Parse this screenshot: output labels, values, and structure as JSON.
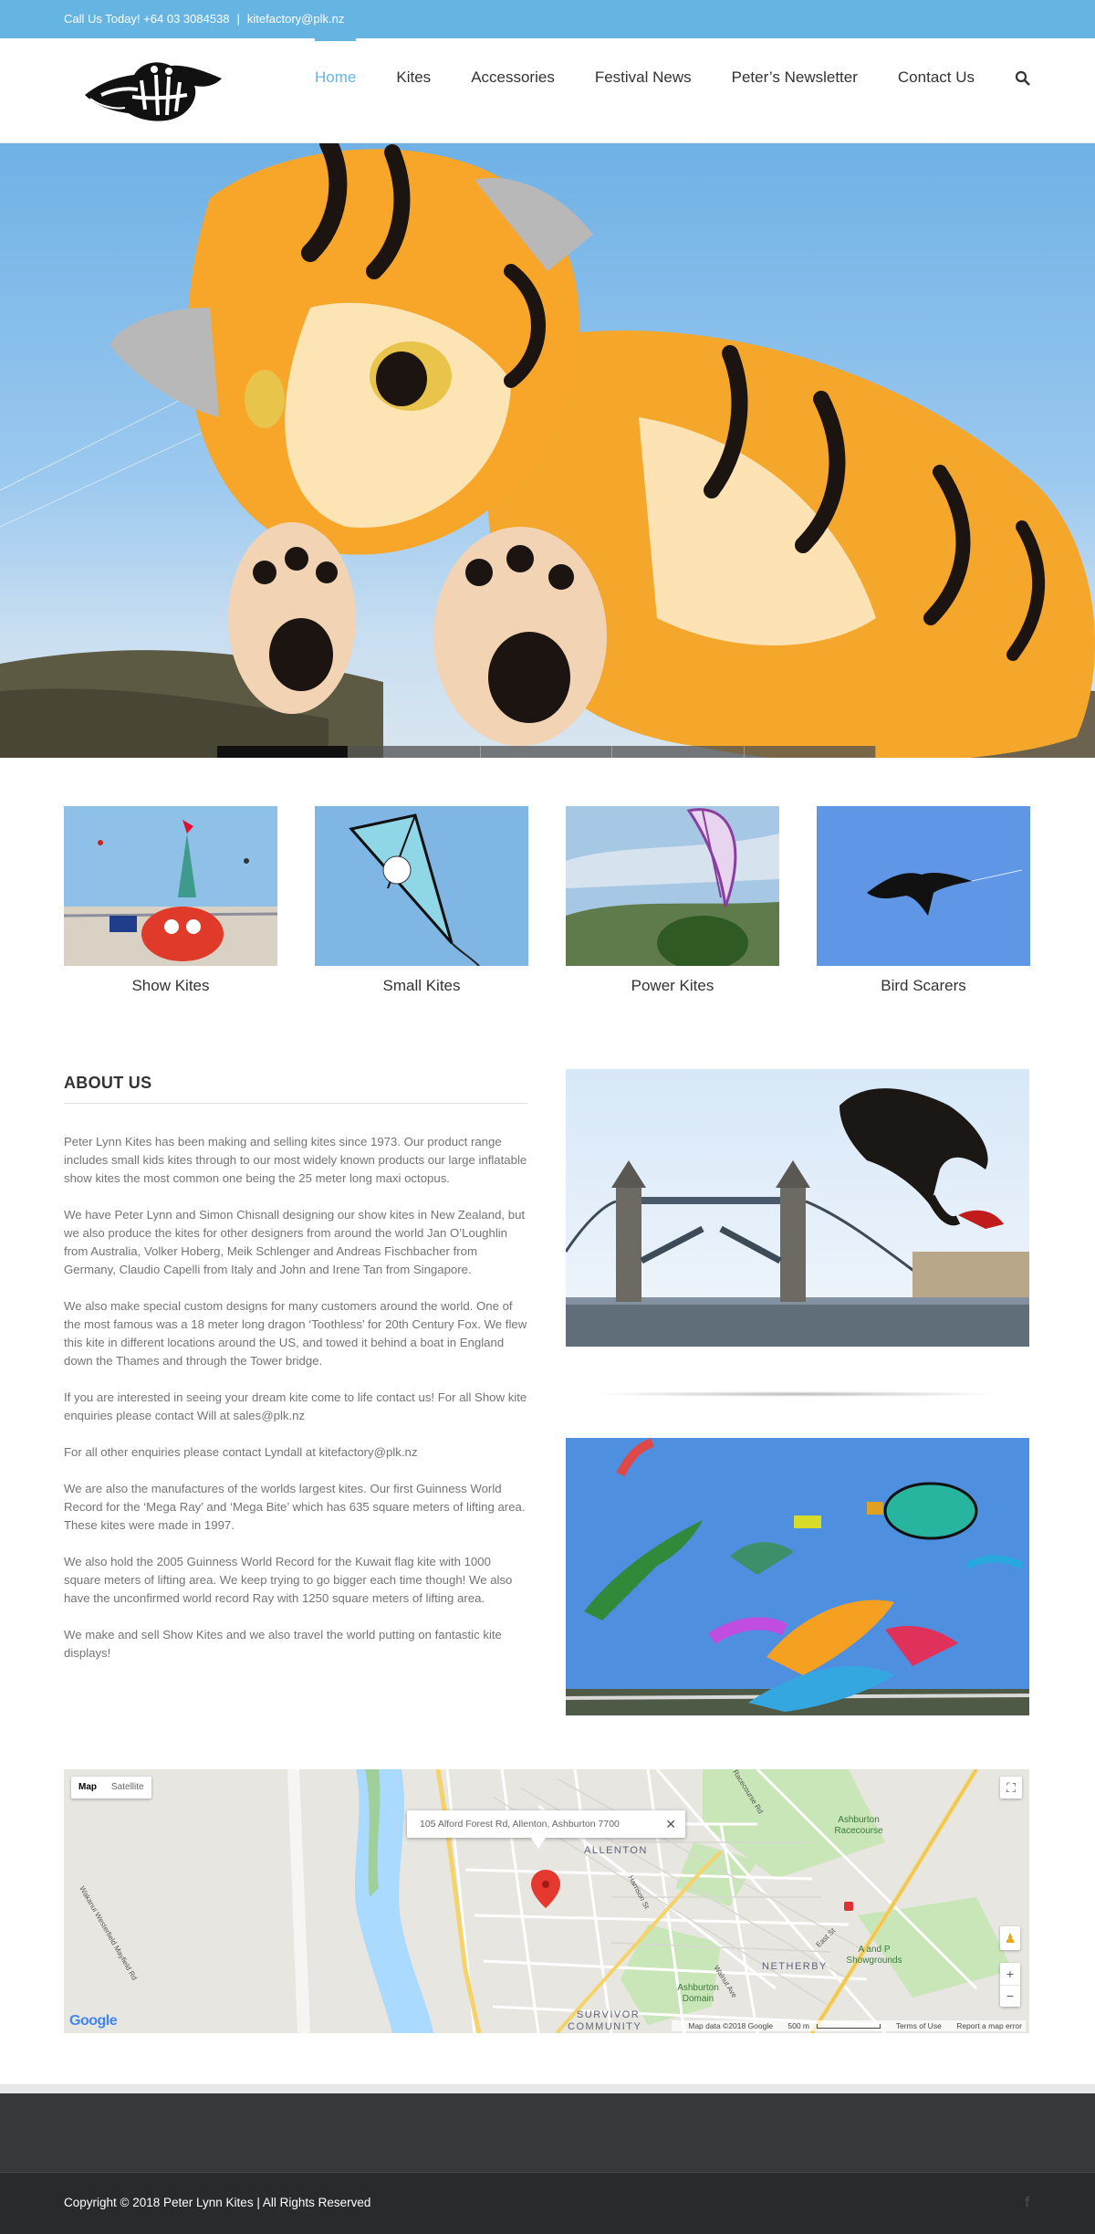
{
  "topbar": {
    "phone": "Call Us Today! +64 03 3084538",
    "separator": "|",
    "email": "kitefactory@plk.nz"
  },
  "header": {
    "logo_icon": "peter-lynn-kites-logo",
    "nav": [
      {
        "label": "Home",
        "active": true
      },
      {
        "label": "Kites",
        "active": false
      },
      {
        "label": "Accessories",
        "active": false
      },
      {
        "label": "Festival News",
        "active": false
      },
      {
        "label": "Peter’s Newsletter",
        "active": false
      },
      {
        "label": "Contact Us",
        "active": false
      }
    ],
    "search_icon": "search-icon",
    "accent_color": "#66b4e1"
  },
  "hero": {
    "slides": 5,
    "active_slide": 1
  },
  "categories": [
    {
      "label": "Show Kites"
    },
    {
      "label": "Small Kites"
    },
    {
      "label": "Power Kites"
    },
    {
      "label": "Bird Scarers"
    }
  ],
  "about": {
    "title": "ABOUT US",
    "paragraphs": [
      "Peter Lynn Kites has been making and selling kites since 1973. Our product range includes small kids kites through to our most widely known products our large inflatable show kites the most common one being the 25 meter long maxi octopus.",
      "We have Peter Lynn and Simon Chisnall designing our show kites in New Zealand, but we also produce the kites for other designers from around the world Jan O’Loughlin from Australia, Volker Hoberg, Meik Schlenger and Andreas Fischbacher from Germany, Claudio Capelli from Italy and John and Irene Tan from Singapore.",
      "We also make special custom designs for many customers around the world. One of the most famous was a 18 meter long dragon ‘Toothless’ for 20th Century Fox. We flew this kite in different locations around the US, and towed it behind a boat in England down the Thames and through the Tower bridge.",
      "If you are interested in seeing your dream kite come to life contact us! For all Show kite enquiries please contact Will at sales@plk.nz",
      "For all other enquiries please contact Lyndall at kitefactory@plk.nz",
      "We are also the manufactures of the worlds largest kites. Our first Guinness World Record for the ‘Mega Ray’ and ‘Mega Bite’ which has 635 square meters of lifting area. These kites were made in 1997.",
      "We also hold the 2005 Guinness World Record for the Kuwait flag kite with 1000 square meters of lifting area. We keep trying to go bigger each time though! We also have the unconfirmed world record Ray with 1250 square meters of lifting area.",
      "We make and sell Show Kites and we also travel the world putting on fantastic kite displays!"
    ]
  },
  "map": {
    "type_map": "Map",
    "type_satellite": "Satellite",
    "info_address": "105 Alford Forest Rd, Allenton, Ashburton 7700",
    "close_glyph": "✕",
    "labels": {
      "allenton": "ALLENTON",
      "netherby": "NETHERBY",
      "survivor": "SURVIVOR",
      "community": "COMMUNITY",
      "racecourse": "Ashburton Racecourse",
      "showgrounds": "A and P Showgrounds",
      "domain": "Ashburton Domain",
      "harrison": "Harrison St",
      "walnut": "Walnut Ave",
      "racecourse_rd": "Racecourse Rd",
      "east": "East St",
      "mayfield": "Wakanui Westerfield Mayfield Rd"
    },
    "zoom_in": "+",
    "zoom_out": "−",
    "footer": {
      "data": "Map data ©2018 Google",
      "scale": "500 m",
      "terms": "Terms of Use",
      "report": "Report a map error"
    },
    "google_logo": "Google"
  },
  "footer": {
    "copyright": "Copyright © 2018 Peter Lynn Kites | All Rights Reserved",
    "social_icon": "facebook-icon",
    "social_glyph": "f"
  }
}
